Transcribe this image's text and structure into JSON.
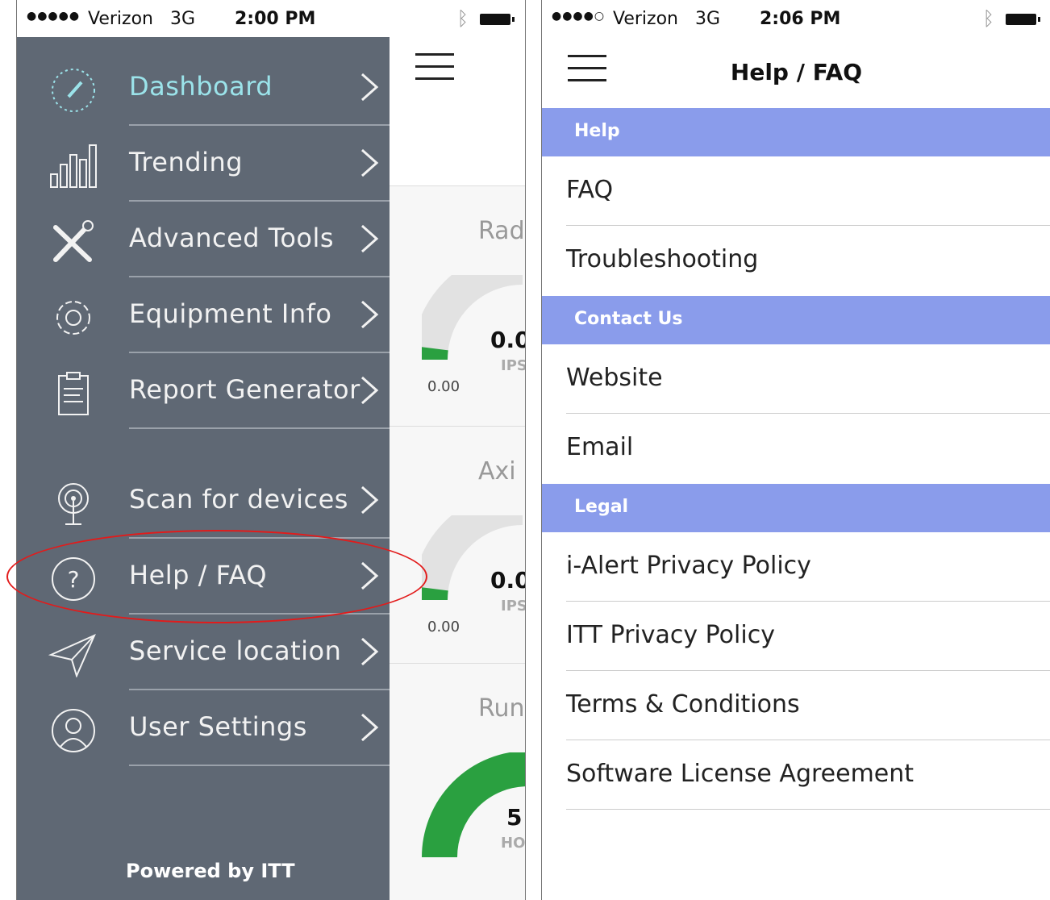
{
  "left_screen": {
    "status": {
      "signal": "●●●●●",
      "carrier": "Verizon",
      "network": "3G",
      "time": "2:00 PM"
    },
    "menu": [
      {
        "label": "Dashboard",
        "icon": "speedometer-icon",
        "active": true
      },
      {
        "label": "Trending",
        "icon": "bar-chart-icon"
      },
      {
        "label": "Advanced Tools",
        "icon": "tools-icon"
      },
      {
        "label": "Equipment Info",
        "icon": "gear-icon"
      },
      {
        "label": "Report Generator",
        "icon": "clipboard-icon"
      },
      {
        "label": "Scan for devices",
        "icon": "antenna-icon"
      },
      {
        "label": "Help / FAQ",
        "icon": "help-icon"
      },
      {
        "label": "Service location",
        "icon": "location-arrow-icon"
      },
      {
        "label": "User Settings",
        "icon": "user-icon"
      }
    ],
    "footer": "Powered by ITT",
    "dashboard": {
      "cards": [
        {
          "title": "Rad",
          "value": "0.0",
          "unit": "IPS",
          "min": "0.00",
          "level": 0.08
        },
        {
          "title": "Axi",
          "value": "0.0",
          "unit": "IPS",
          "min": "0.00",
          "level": 0.08
        },
        {
          "title": "Runt",
          "value": "5",
          "unit": "HOU"
        }
      ]
    },
    "colors": {
      "drawer": "#5f6874",
      "active_label": "#9be3ea",
      "gauge_fill": "#2aa040",
      "highlight": "#e21b1b"
    }
  },
  "right_screen": {
    "status": {
      "signal": "●●●●○",
      "carrier": "Verizon",
      "network": "3G",
      "time": "2:06 PM"
    },
    "title": "Help / FAQ",
    "sections": [
      {
        "header": "Help",
        "items": [
          "FAQ",
          "Troubleshooting"
        ]
      },
      {
        "header": "Contact Us",
        "items": [
          "Website",
          "Email"
        ]
      },
      {
        "header": "Legal",
        "items": [
          "i-Alert Privacy Policy",
          "ITT Privacy Policy",
          "Terms & Conditions",
          "Software License Agreement"
        ]
      }
    ],
    "colors": {
      "section_bg": "#8a9ceb"
    }
  }
}
